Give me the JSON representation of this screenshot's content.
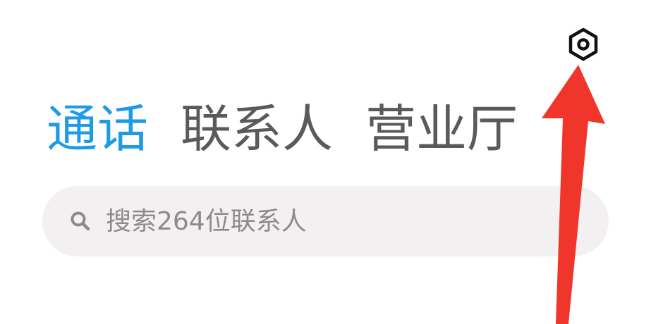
{
  "header": {
    "settings_icon": "gear-hexagon-icon"
  },
  "tabs": [
    {
      "label": "通话",
      "active": true
    },
    {
      "label": "联系人",
      "active": false
    },
    {
      "label": "营业厅",
      "active": false
    }
  ],
  "search": {
    "icon": "search-icon",
    "placeholder": "搜索264位联系人"
  },
  "colors": {
    "accent": "#1e9be6",
    "tab_inactive": "#5a5a5a",
    "search_bg": "#f2f0f0",
    "annotation_arrow": "#f0362b"
  }
}
